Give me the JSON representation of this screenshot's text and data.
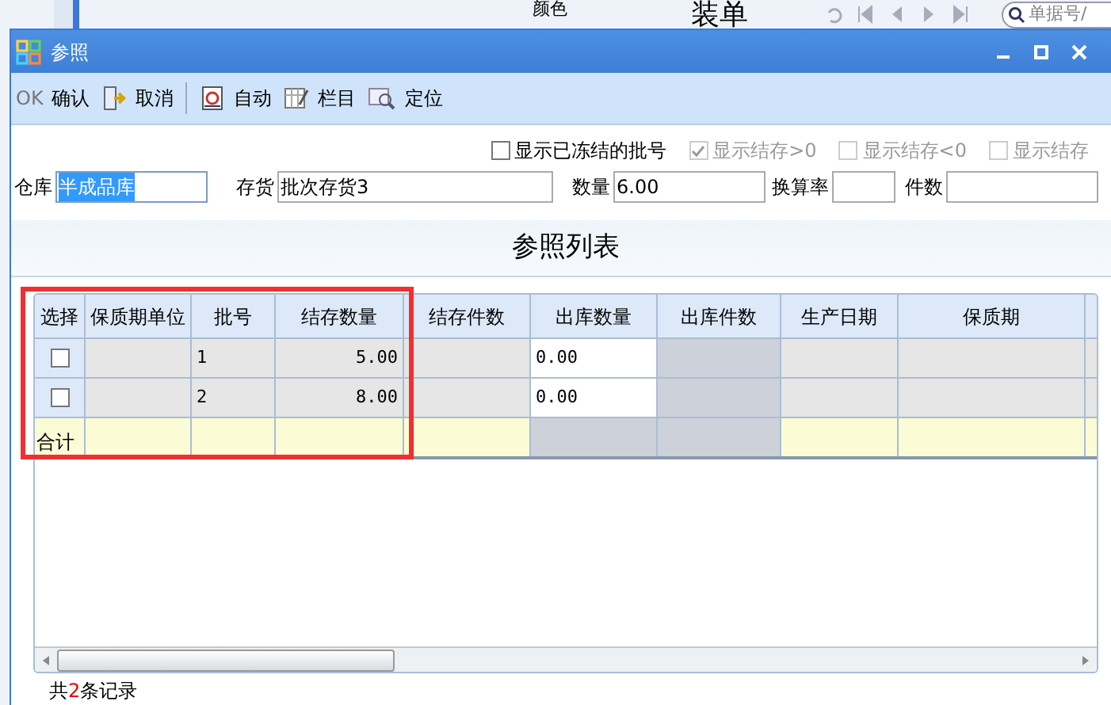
{
  "background": {
    "color_label": "颜色",
    "title": "装单",
    "search": {
      "placeholder": "单据号/"
    }
  },
  "window": {
    "title": "参照"
  },
  "toolbar": [
    {
      "kind": "ok",
      "prefix": "OK",
      "label": "确认"
    },
    {
      "kind": "exit",
      "label": "取消"
    },
    {
      "kind": "auto",
      "label": "自动"
    },
    {
      "kind": "columns",
      "label": "栏目"
    },
    {
      "kind": "locate",
      "label": "定位"
    }
  ],
  "options": [
    {
      "label": "显示已冻结的批号",
      "checked": false,
      "disabled": false
    },
    {
      "label": "显示结存>0",
      "checked": true,
      "disabled": true
    },
    {
      "label": "显示结存<0",
      "checked": false,
      "disabled": true
    },
    {
      "label": "显示结存",
      "checked": false,
      "disabled": true
    }
  ],
  "fields": [
    {
      "label": "仓库",
      "value": "半成品库",
      "selected": true
    },
    {
      "label": "存货",
      "value": "批次存货3",
      "selected": false
    },
    {
      "label": "数量",
      "value": "6.00",
      "selected": false
    },
    {
      "label": "换算率",
      "selected": false
    },
    {
      "label": "件数",
      "selected": false
    }
  ],
  "list_title": "参照列表",
  "table": {
    "columns": [
      "选择",
      "保质期单位",
      "批号",
      "结存数量",
      "结存件数",
      "出库数量",
      "出库件数",
      "生产日期",
      "保质期"
    ],
    "rows": [
      {
        "checked": false,
        "cells": [
          "",
          "1",
          "5.00",
          "",
          "0.00",
          "",
          "",
          ""
        ]
      },
      {
        "checked": false,
        "cells": [
          "",
          "2",
          "8.00",
          "",
          "0.00",
          "",
          "",
          ""
        ]
      }
    ],
    "total_label": "合计"
  },
  "footer": {
    "prefix": "共",
    "count": "2",
    "suffix": "条记录"
  }
}
